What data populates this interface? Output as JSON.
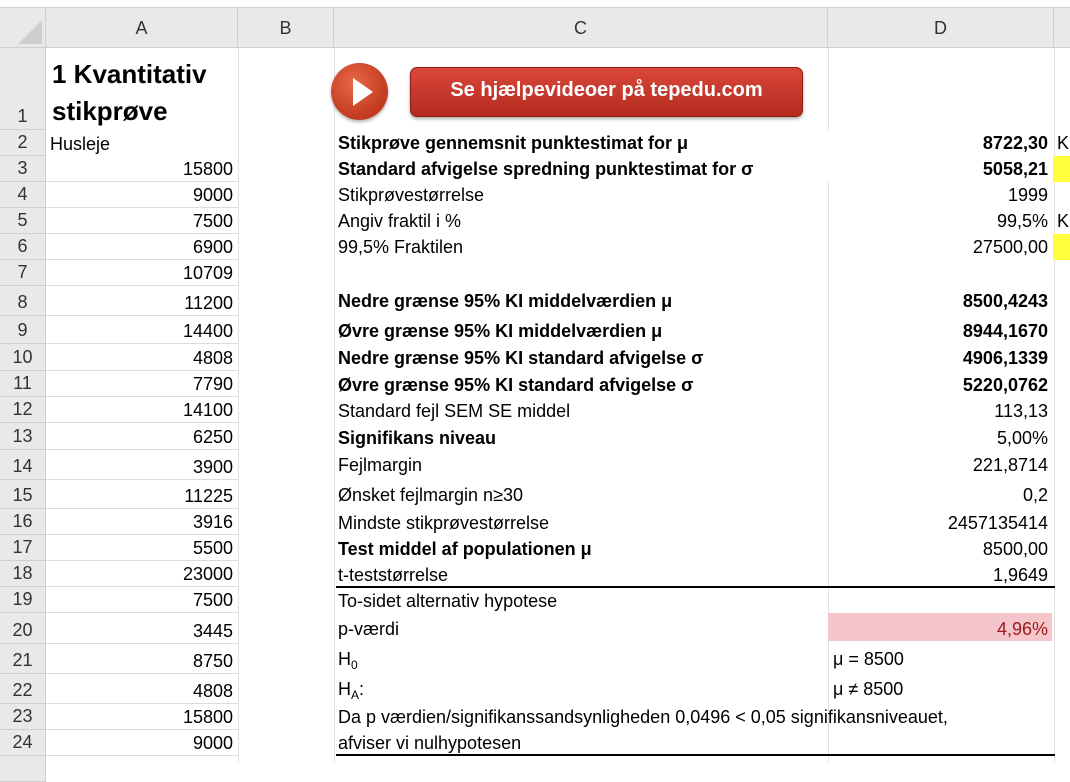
{
  "columns": {
    "a": "A",
    "b": "B",
    "c": "C",
    "d": "D"
  },
  "rows": [
    "1",
    "2",
    "3",
    "4",
    "5",
    "6",
    "7",
    "8",
    "9",
    "10",
    "11",
    "12",
    "13",
    "14",
    "15",
    "16",
    "17",
    "18",
    "19",
    "20",
    "21",
    "22",
    "23",
    "24"
  ],
  "title": {
    "line1": "1 Kvantitativ",
    "line2": "stikprøve"
  },
  "help_button": "Se hjælpevideoer på tepedu.com",
  "column_a": {
    "header": "Husleje",
    "values": [
      "15800",
      "9000",
      "7500",
      "6900",
      "10709",
      "11200",
      "14400",
      "4808",
      "7790",
      "14100",
      "6250",
      "3900",
      "11225",
      "3916",
      "5500",
      "23000",
      "7500",
      "3445",
      "8750",
      "4808",
      "15800",
      "9000"
    ]
  },
  "stats": {
    "r2_label": "Stikprøve gennemsnit punktestimat for μ",
    "r2_value": "8722,30",
    "r3_label": "Standard afvigelse spredning punktestimat for σ",
    "r3_value": "5058,21",
    "r4_label": "Stikprøvestørrelse",
    "r4_value": "1999",
    "r5_label": "Angiv fraktil i %",
    "r5_value": "99,5%",
    "r6_label": "99,5% Fraktilen",
    "r6_value": "27500,00",
    "r8_label": "Nedre grænse 95% KI middelværdien μ",
    "r8_value": "8500,4243",
    "r9_label": "Øvre grænse 95% KI middelværdien μ",
    "r9_value": "8944,1670",
    "r10_label": "Nedre grænse 95% KI standard afvigelse σ",
    "r10_value": "4906,1339",
    "r11_label": "Øvre grænse 95% KI standard afvigelse σ",
    "r11_value": "5220,0762",
    "r12_label": "Standard fejl SEM SE middel",
    "r12_value": "113,13",
    "r13_label": "Signifikans niveau",
    "r13_value": "5,00%",
    "r14_label": "Fejlmargin",
    "r14_value": "221,8714",
    "r15_label": "Ønsket fejlmargin n≥30",
    "r15_value": "0,2",
    "r16_label": "Mindste stikprøvestørrelse",
    "r16_value": "2457135414",
    "r17_label": "Test middel af populationen μ",
    "r17_value": "8500,00",
    "r18_label": "t-teststørrelse",
    "r18_value": "1,9649",
    "r19_label": "To-sidet alternativ hypotese",
    "r20_label": "p-værdi",
    "r20_value": "4,96%",
    "r21_label_main": "H",
    "r21_label_sub": "0",
    "r21_value": "μ = 8500",
    "r22_label_main": "H",
    "r22_label_sub": "A",
    "r22_label_suffix": ":",
    "r22_value": "μ ≠ 8500",
    "r23_text": "Da p værdien/signifikanssandsynligheden 0,0496 < 0,05 signifikansniveauet,",
    "r24_text": "afviser vi nulhypotesen",
    "k_char": "K"
  },
  "colors": {
    "play": "#d2452a",
    "button": "#c2342a",
    "pvalue_bg": "#f4c6cb",
    "pvalue_text": "#9c1c1c",
    "highlight": "#ffff3c"
  }
}
